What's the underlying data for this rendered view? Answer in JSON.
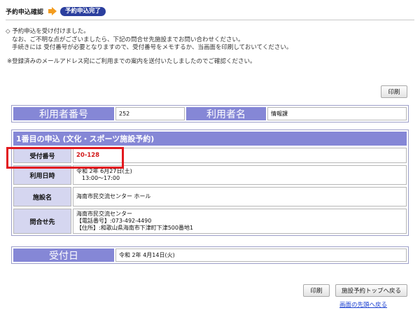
{
  "steps": {
    "current": "予約申込確認",
    "done": "予約申込完了"
  },
  "notice": {
    "line1": "◇ 予約申込を受け付けました。",
    "line2": "なお、ご不明な点がございましたら、下記の問合せ先施設までお問い合わせください。",
    "line3": "手続きには 受付番号が必要となりますので、受付番号をメモするか、当画面を印刷しておいてください。",
    "line4": "※登録済みのメールアドレス宛にご利用までの案内を送付いたしましたのでご確認ください。"
  },
  "buttons": {
    "print": "印刷",
    "back_to_top": "施設予約トップへ戻る"
  },
  "user": {
    "number_label": "利用者番号",
    "number_value": "252",
    "name_label": "利用者名",
    "name_value": "情報課"
  },
  "application": {
    "title": "1番目の申込 (文化・スポーツ施設予約)",
    "rows": [
      {
        "label": "受付番号",
        "lines": [
          "20-128"
        ]
      },
      {
        "label": "利用日時",
        "lines": [
          "令和 2年 6月27日(土)",
          "13:00〜17:00"
        ]
      },
      {
        "label": "施設名",
        "lines": [
          "海南市民交流センター ホール"
        ]
      },
      {
        "label": "問合せ先",
        "lines": [
          "海南市民交流センター",
          "【電話番号】:073-492-4490",
          "【住所】:和歌山県海南市下津町下津500番地1"
        ]
      }
    ]
  },
  "received": {
    "label": "受付日",
    "value": "令和 2年 4月14日(火)"
  },
  "links": {
    "page_top": "画面の先頭へ戻る"
  },
  "colors": {
    "header_purple": "#8587d6",
    "row_label_bg": "#d5d6f0",
    "step_done_bg": "#2b3f9e",
    "arrow_orange": "#f39c1f",
    "highlight_red": "#e2191f",
    "link_blue": "#1a3fd0"
  }
}
